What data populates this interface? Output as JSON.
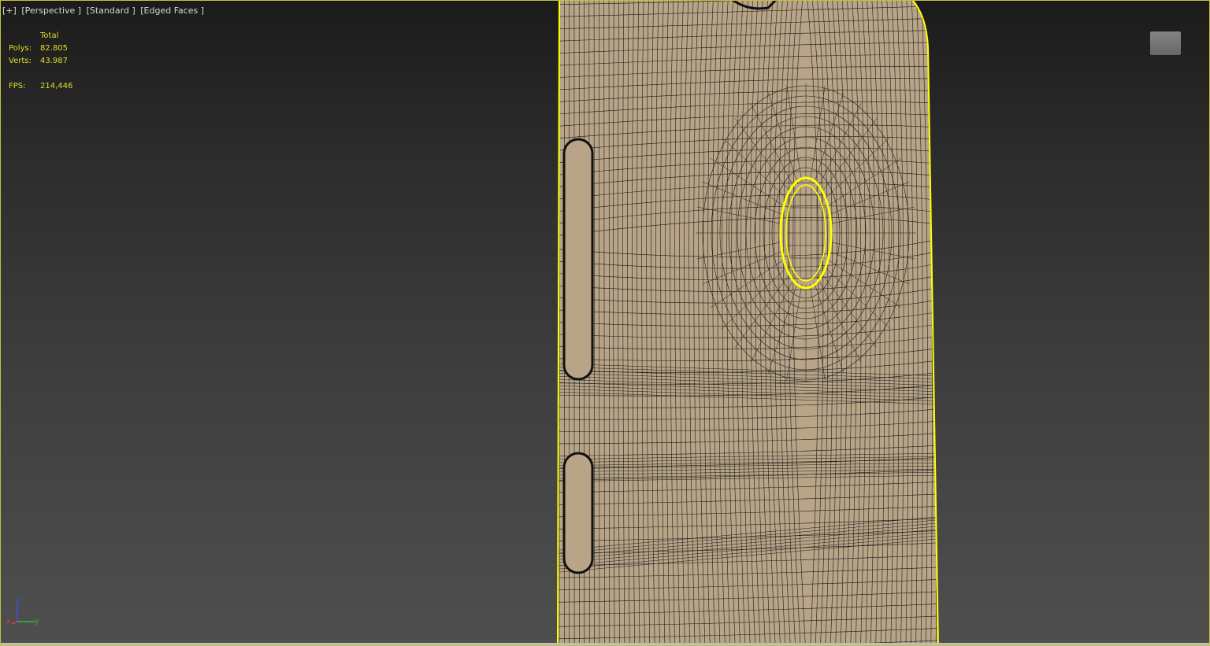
{
  "viewport_labels": [
    "[+]",
    "[Perspective ]",
    "[Standard ]",
    "[Edged Faces ]"
  ],
  "stats": {
    "header": "Total",
    "polys_label": "Polys:",
    "polys_value": "82.805",
    "verts_label": "Verts:",
    "verts_value": "43.987",
    "fps_label": "FPS:",
    "fps_value": "214,446"
  },
  "viewcube": {
    "icon": "viewcube-icon"
  },
  "axis": {
    "z": "z",
    "x": "x",
    "y": "y"
  },
  "colors": {
    "selection": "#ffff00",
    "mesh_fill": "#b8a487",
    "wire": "#1c1c1c",
    "stats_text": "#e5df28"
  }
}
